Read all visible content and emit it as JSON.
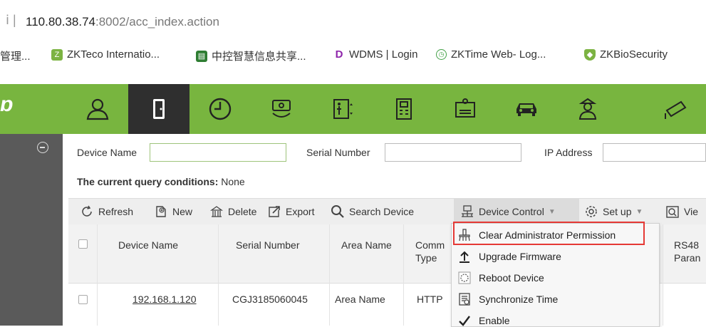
{
  "browser": {
    "url_host": "110.80.38.74",
    "url_rest": ":8002/acc_index.action",
    "bookmarks": [
      {
        "label": "管理...",
        "icon": "folder-icon"
      },
      {
        "label": "ZKTeco Internatio...",
        "icon": "zkteco-icon"
      },
      {
        "label": "中控智慧信息共享...",
        "icon": "share-icon"
      },
      {
        "label": "WDMS | Login",
        "icon": "wdms-icon"
      },
      {
        "label": "ZKTime Web- Log...",
        "icon": "clock-icon"
      },
      {
        "label": "ZKBioSecurity",
        "icon": "shield-icon"
      }
    ]
  },
  "nav": {
    "items": [
      "person-icon",
      "door-icon",
      "attendance-clock-icon",
      "payment-icon",
      "elevator-icon",
      "building-icon",
      "visitor-card-icon",
      "parking-car-icon",
      "guard-icon",
      "camera-icon"
    ],
    "active_index": 1
  },
  "filters": {
    "device_name_label": "Device Name",
    "serial_number_label": "Serial Number",
    "ip_address_label": "IP Address",
    "device_name_value": "",
    "serial_number_value": "",
    "ip_address_value": ""
  },
  "query": {
    "label": "The current query conditions:",
    "value": "None"
  },
  "toolbar": {
    "refresh": "Refresh",
    "new": "New",
    "delete": "Delete",
    "export": "Export",
    "search_device": "Search Device",
    "device_control": "Device Control",
    "set_up": "Set up",
    "view": "Vie"
  },
  "table": {
    "headers": {
      "device_name": "Device Name",
      "serial_number": "Serial Number",
      "area_name": "Area Name",
      "comm_type_1": "Comm",
      "comm_type_2": "Type",
      "rs485_1": "RS48",
      "rs485_2": "Paran"
    },
    "rows": [
      {
        "device_name": "192.168.1.120",
        "serial_number": "CGJ3185060045",
        "area_name": "Area Name",
        "comm_type": "HTTP"
      }
    ]
  },
  "dropdown": {
    "items": [
      {
        "label": "Clear Administrator Permission",
        "icon": "clear-permission-icon",
        "highlighted": true
      },
      {
        "label": "Upgrade Firmware",
        "icon": "upgrade-icon"
      },
      {
        "label": "Reboot Device",
        "icon": "reboot-icon"
      },
      {
        "label": "Synchronize Time",
        "icon": "sync-time-icon"
      },
      {
        "label": "Enable",
        "icon": "enable-icon"
      }
    ]
  },
  "colors": {
    "nav_green": "#78b53f",
    "nav_active": "#2f2f2f",
    "sidebar": "#5a5a5a",
    "highlight_border": "#e53935"
  }
}
